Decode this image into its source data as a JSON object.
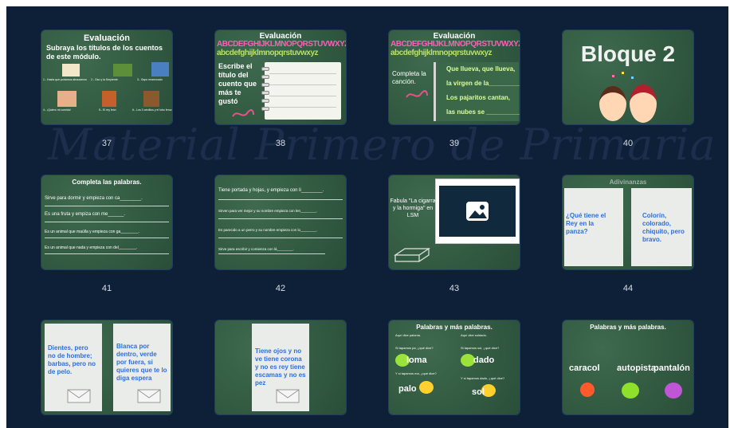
{
  "watermark": "Material Primero de Primaria",
  "slides": [
    {
      "num": "37",
      "title": "Evaluación",
      "subtitle": "Subraya los títulos de los cuentos de este módulo.",
      "items": [
        "1.- Hasta que podamos abrazarnos",
        "2.- Oso y la Serpiente",
        "3.- Sapo enamorado",
        "4.- ¡Quiero mi comida!",
        "5.- El rey león",
        "6.- Los 3 cerditos y el lobo feroz"
      ]
    },
    {
      "num": "38",
      "title": "Evaluación",
      "letters_upper": "ABCDEFGHIJKLMNOPQRSTUVWXYZ",
      "letters_lower": "abcdefghijklmnopqrstuvwxyz",
      "prompt": "Escribe el título del cuento que más te gustó"
    },
    {
      "num": "39",
      "title": "Evaluación",
      "letters_upper": "ABCDEFGHIJKLMNOPQRSTUVWXYZ",
      "letters_lower": "abcdefghijklmnopqrstuvwxyz",
      "prompt": "Completa la canción.",
      "lines": [
        "Que llueva, que llueva,",
        "la virgen de la____________",
        "Los pajaritos cantan,",
        "las nubes se ____________"
      ]
    },
    {
      "num": "40",
      "title": "Bloque 2"
    },
    {
      "num": "41",
      "title": "Completa las palabras.",
      "lines": [
        "Sirve para dormir y empieza con ca________.",
        "Es una fruta y empiza con me______.",
        "Es un animal que maúlla y empieza con ga________.",
        "Es un animal que nada y empieza con del________."
      ]
    },
    {
      "num": "42",
      "lines": [
        "Tiene portada y hojas, y empieza con li________.",
        "Sirven para ver mejor y su nombre empieza con len________.",
        "Es parecido a un perro y su nombre empieza con lo________.",
        "Sirve para escribir y comienza con lá________."
      ]
    },
    {
      "num": "43",
      "caption": "Fabula \"La cigarra y la hormiga\" en LSM"
    },
    {
      "num": "44",
      "title": "Adivinanzas",
      "riddle_left": "¿Qué tiene el Rey en la panza?",
      "riddle_right": "Colorín, colorado, chiquito, pero bravo."
    },
    {
      "num": "45",
      "riddle_left": "Dientes, pero no de hombre; barbas, pero no de pelo.",
      "riddle_right": "Blanca por dentro, verde por fuera, si quieres que te lo diga espera"
    },
    {
      "num": "46",
      "riddle": "Tiene ojos y no ve tiene corona y no es rey tiene escamas y no es pez"
    },
    {
      "num": "47",
      "title": "Palabras y más palabras.",
      "left_note": "Aquí dice paloma.",
      "left_q": "Si tapamos pa, ¿qué dice?",
      "left_ans": "loma",
      "left_q2": "Y si tapamos ma, ¿qué dice?",
      "left_ans2": "palo",
      "right_note": "Aquí dice soldado.",
      "right_q": "Si tapamos sol, ¿qué dice?",
      "right_ans": "dado",
      "right_q2": "Y si tapamos dado, ¿qué dice?",
      "right_ans2": "sol"
    },
    {
      "num": "48",
      "title": "Palabras y más palabras.",
      "words": [
        "caracol",
        "autopista",
        "pantalón"
      ]
    }
  ],
  "colors": {
    "bg": "#0e1f38",
    "slide": "#335c43",
    "accent_blue": "#2e6fe0",
    "highlight": "#5fb7ff"
  }
}
